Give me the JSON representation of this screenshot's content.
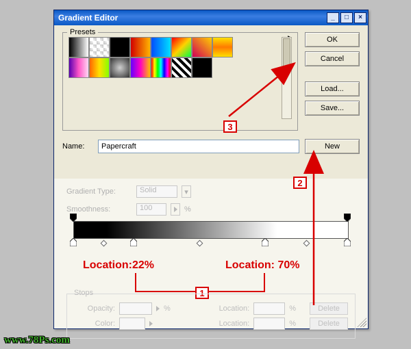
{
  "window": {
    "title": "Gradient Editor",
    "min_icon": "minimize-icon",
    "max_icon": "maximize-icon",
    "close_icon": "close-icon"
  },
  "presets": {
    "legend": "Presets",
    "popout_icon": "chevron-right-icon",
    "annotation_3": "3",
    "swatches": [
      {
        "css": "linear-gradient(to right,#000,#fff)"
      },
      {
        "css": "radial-gradient(circle,#fff 0%,transparent 70%), repeating-conic-gradient(#ccc 0 25%, #fff 0 50%)"
      },
      {
        "css": "linear-gradient(to bottom,#000,#000)"
      },
      {
        "css": "linear-gradient(to right,#d20000,#ffb400)"
      },
      {
        "css": "linear-gradient(to right,#004dff,#00e0ff)"
      },
      {
        "css": "linear-gradient(135deg,#ff0000,#ffd200,#00ff44)"
      },
      {
        "css": "linear-gradient(45deg,#d10056,#ffce00)"
      },
      {
        "css": "linear-gradient(to bottom,#ffe000,#ff7a00,#ffe000)"
      },
      {
        "css": "linear-gradient(to right,#5a00b0,#ff56c8,#ffd6f2)"
      },
      {
        "css": "linear-gradient(to right,#ff6600,#ffe000,#86ff00)"
      },
      {
        "css": "radial-gradient(circle,#d0d0d0 0,#333 100%)"
      },
      {
        "css": "linear-gradient(to right,#6600ff,#ff00c3,#ffbf00)"
      },
      {
        "css": "linear-gradient(to right,#ff0000,#ffff00,#00ff00,#00ffff,#0000ff,#ff00ff,#ff0000)"
      },
      {
        "css": "repeating-linear-gradient(45deg,#000 0 4px,#fff 4px 8px)"
      },
      {
        "css": "linear-gradient(to bottom,#000,#000)"
      }
    ]
  },
  "sidebuttons": {
    "ok": "OK",
    "cancel": "Cancel",
    "load": "Load...",
    "save": "Save..."
  },
  "name": {
    "label": "Name:",
    "value": "Papercraft",
    "new_btn": "New"
  },
  "annotation_1": "1",
  "annotation_2": "2",
  "gradient_type": {
    "label": "Gradient Type:",
    "value": "Solid"
  },
  "smoothness": {
    "label": "Smoothness:",
    "value": "100",
    "unit": "%"
  },
  "gradient_bar": {
    "top_stops_pct": [
      0,
      100
    ],
    "bottom_stops_pct": [
      0,
      22,
      70,
      100
    ],
    "diamonds_pct": [
      11,
      46,
      85
    ]
  },
  "stop_labels": {
    "left": "Location:22%",
    "right": "Location: 70%"
  },
  "stops_group": {
    "legend": "Stops",
    "opacity_label": "Opacity:",
    "opacity_value": "",
    "opacity_unit": "%",
    "location_label": "Location:",
    "location_value": "",
    "location_unit": "%",
    "color_label": "Color:",
    "color_location_label": "Location:",
    "delete_btn": "Delete"
  },
  "watermark": "www.78Ps.com",
  "colors": {
    "accent_red": "#d80000"
  }
}
